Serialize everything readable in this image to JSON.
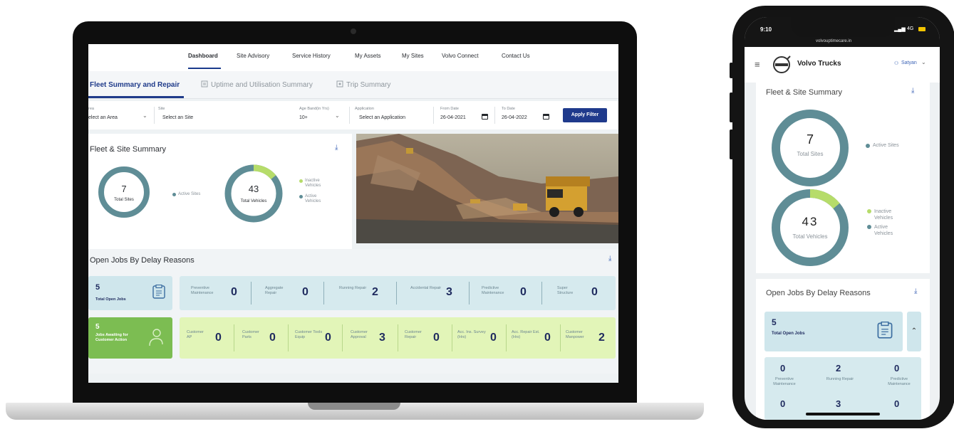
{
  "laptop": {
    "nav": [
      "Dashboard",
      "Site Advisory",
      "Service History",
      "My Assets",
      "My Sites",
      "Volvo Connect",
      "Contact Us"
    ],
    "tabs": [
      "Fleet Summary and Repair",
      "Uptime and Utilisation Summary",
      "Trip Summary"
    ],
    "filters": {
      "area_label": "rea",
      "area_value": "elect an Area",
      "site_label": "Site",
      "site_value": "Select an Site",
      "ageband_label": "Age Band(in Yrs)",
      "ageband_value": "10+",
      "application_label": "Application",
      "application_value": "Select an Application",
      "from_label": "From Date",
      "from_value": "26-04-2021",
      "to_label": "To Date",
      "to_value": "26-04-2022",
      "apply_label": "Apply Filter"
    },
    "fleet": {
      "title": "Fleet & Site Summary",
      "sites_value": "7",
      "sites_label": "Total Sites",
      "sites_legend": "Active Sites",
      "vehicles_value": "43",
      "vehicles_label": "Total Vehicles",
      "legend_inactive": "Inactive Vehicles",
      "legend_active": "Active Vehicles"
    },
    "jobs": {
      "title": "Open Jobs By Delay Reasons",
      "total_value": "5",
      "total_label": "Total Open Jobs",
      "awaiting_value": "5",
      "awaiting_label": "Jobs Awaiting for Customer Action",
      "row1": [
        {
          "label": "Preventive Maintenance",
          "value": "0"
        },
        {
          "label": "Aggregate Repair",
          "value": "0"
        },
        {
          "label": "Running Repair",
          "value": "2"
        },
        {
          "label": "Accidental Repair",
          "value": "3"
        },
        {
          "label": "Predictive Maintenance",
          "value": "0"
        },
        {
          "label": "Super Structure",
          "value": "0"
        }
      ],
      "row2": [
        {
          "label": "Customer AP",
          "value": "0"
        },
        {
          "label": "Customer Parts",
          "value": "0"
        },
        {
          "label": "Customer Tools Equip",
          "value": "0"
        },
        {
          "label": "Customer Approval",
          "value": "3"
        },
        {
          "label": "Customer Repair",
          "value": "0"
        },
        {
          "label": "Acc. Ins. Survey (Hrs)",
          "value": "0"
        },
        {
          "label": "Acc. Repair Est. (Hrs)",
          "value": "0"
        },
        {
          "label": "Customer Manpower",
          "value": "2"
        }
      ]
    }
  },
  "phone": {
    "time": "9:10",
    "network": "4G",
    "url": "volvouptimecare.in",
    "brand": "Volvo Trucks",
    "user": "Satyan",
    "fleet_title": "Fleet & Site Summary",
    "sites_value": "7",
    "sites_label": "Total Sites",
    "sites_legend": "Active Sites",
    "vehicles_value": "43",
    "vehicles_label": "Total Vehicles",
    "legend_inactive": "Inactive Vehicles",
    "legend_active": "Active Vehicles",
    "jobs_title": "Open Jobs By Delay Reasons",
    "total_value": "5",
    "total_label": "Total Open Jobs",
    "grid": [
      {
        "value": "0",
        "label": "Preventive Maintenance"
      },
      {
        "value": "2",
        "label": "Running Repair"
      },
      {
        "value": "0",
        "label": "Predictive Maintenance"
      },
      {
        "value": "0",
        "label": ""
      },
      {
        "value": "3",
        "label": ""
      },
      {
        "value": "0",
        "label": ""
      }
    ]
  },
  "colors": {
    "brand": "#1f3a8c",
    "donut_teal": "#5f8d96",
    "donut_green": "#b6dc6a",
    "tile_blue": "#cfe6ec",
    "tile_green": "#e2f5b8",
    "awaiting_green": "#7cbd52"
  },
  "vehicle_breakdown": {
    "inactive_fraction": 0.14
  }
}
